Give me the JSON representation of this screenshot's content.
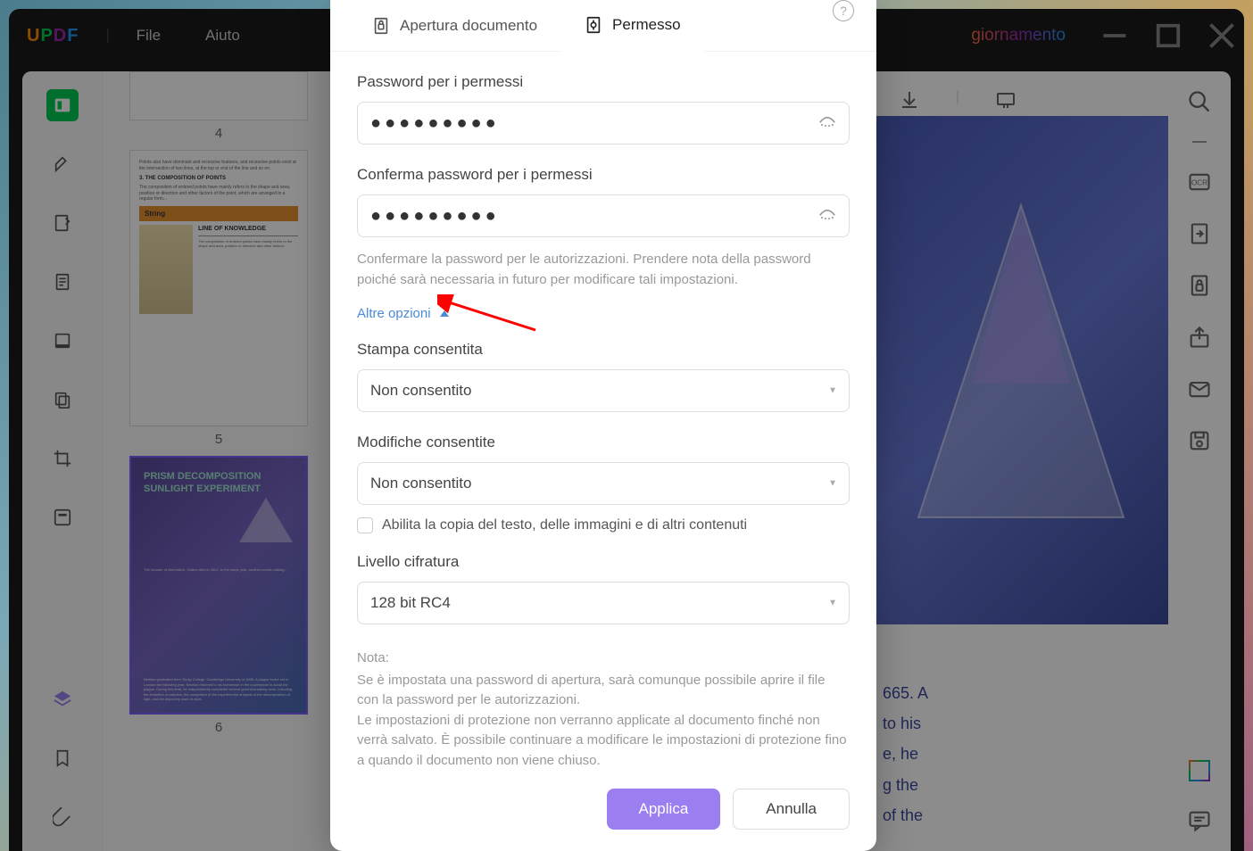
{
  "app": {
    "logo": "UPDF",
    "menu": {
      "file": "File",
      "help": "Aiuto"
    },
    "update": "giornamento"
  },
  "thumbnails": {
    "page4": "4",
    "page5": "5",
    "page6": "6",
    "string_heading": "String",
    "line_heading": "LINE OF KNOWLEDGE",
    "comp_title": "3. THE COMPOSITION OF POINTS",
    "prism_title": "PRISM DECOMPOSITION SUNLIGHT EXPERIMENT"
  },
  "main_text": "665. A\nto his\ne, he\ng the\nof the",
  "modal": {
    "tabs": {
      "open": "Apertura documento",
      "permission": "Permesso"
    },
    "password_label": "Password per i permessi",
    "password_value": "●●●●●●●●●",
    "confirm_label": "Conferma password per i permessi",
    "confirm_value": "●●●●●●●●●",
    "confirm_hint": "Confermare la password per le autorizzazioni. Prendere nota della password poiché sarà necessaria in futuro per modificare tali impostazioni.",
    "more_options": "Altre opzioni",
    "print_label": "Stampa consentita",
    "print_value": "Non consentito",
    "edit_label": "Modifiche consentite",
    "edit_value": "Non consentito",
    "copy_label": "Abilita la copia del testo, delle immagini e di altri contenuti",
    "encrypt_label": "Livello cifratura",
    "encrypt_value": "128 bit RC4",
    "note_title": "Nota:",
    "note_body1": "Se è impostata una password di apertura, sarà comunque possibile aprire il file con la password per le autorizzazioni.",
    "note_body2": "Le impostazioni di protezione non verranno applicate al documento finché non verrà salvato. È possibile continuare a modificare le impostazioni di protezione fino a quando il documento non viene chiuso.",
    "apply": "Applica",
    "cancel": "Annulla"
  }
}
